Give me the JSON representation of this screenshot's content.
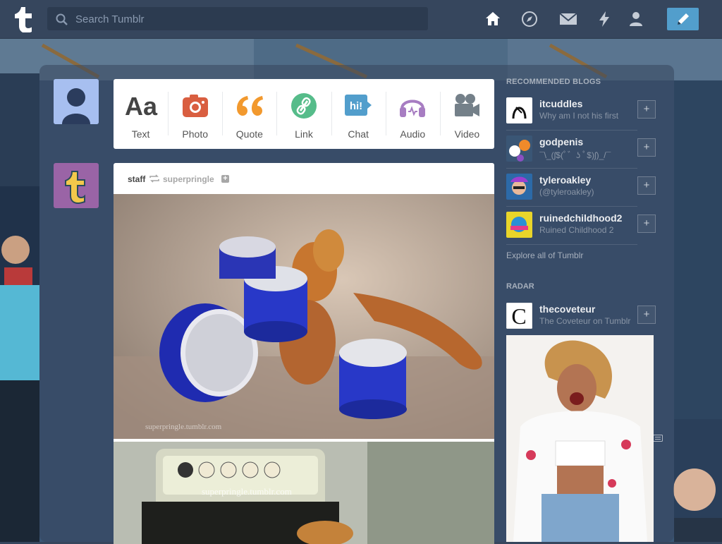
{
  "header": {
    "logo_icon": "tumblr-logo",
    "search_placeholder": "Search Tumblr",
    "nav_icons": [
      "home-icon",
      "explore-icon",
      "mail-icon",
      "activity-icon",
      "account-icon"
    ],
    "compose_icon": "pencil-icon",
    "accent": "#529ecc"
  },
  "post_types": [
    {
      "label": "Text",
      "icon": "text-icon",
      "color": "#444444"
    },
    {
      "label": "Photo",
      "icon": "camera-icon",
      "color": "#d95e40"
    },
    {
      "label": "Quote",
      "icon": "quote-icon",
      "color": "#f2992e"
    },
    {
      "label": "Link",
      "icon": "link-icon",
      "color": "#56bc8a"
    },
    {
      "label": "Chat",
      "icon": "chat-icon",
      "color": "#529ecc"
    },
    {
      "label": "Audio",
      "icon": "headphones-icon",
      "color": "#a77dc2"
    },
    {
      "label": "Video",
      "icon": "video-camera-icon",
      "color": "#748089"
    }
  ],
  "post": {
    "author": "staff",
    "reblogged_from": "superpringle",
    "watermark_1": "superpringle.tumblr.com",
    "watermark_2": "superpringle.tumblr.com"
  },
  "sidebar": {
    "recommended_title": "RECOMMENDED BLOGS",
    "blogs": [
      {
        "name": "itcuddles",
        "desc": "Why am I not his first"
      },
      {
        "name": "godpenis",
        "desc": "¯\\_(ʃ$(ﾟ゛ʖ ﾟ$)ʃ)_/¯"
      },
      {
        "name": "tyleroakley",
        "desc": "(@tyleroakley)"
      },
      {
        "name": "ruinedchildhood2",
        "desc": "Ruined Childhood 2"
      }
    ],
    "explore_label": "Explore all of Tumblr",
    "radar_title": "RADAR",
    "radar_blog": {
      "name": "thecoveteur",
      "desc": "The Coveteur on Tumblr"
    }
  }
}
